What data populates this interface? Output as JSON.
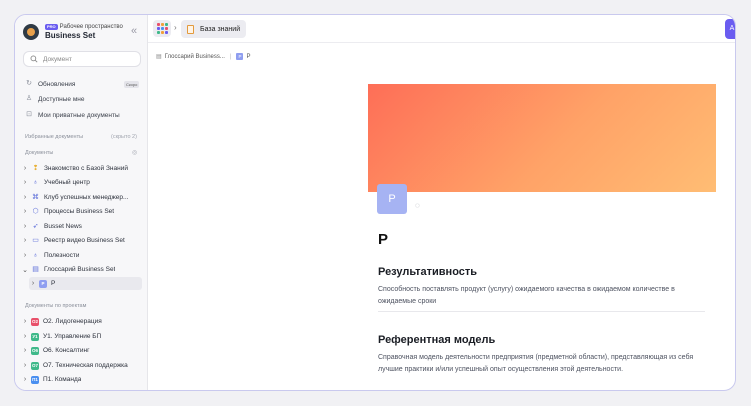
{
  "workspace": {
    "caption": "Рабочее пространство",
    "badge": "PRO",
    "name": "Business Set",
    "collapse": "«"
  },
  "search": {
    "placeholder": "Документ"
  },
  "nav": [
    {
      "label": "Обновления",
      "icon": "refresh-icon",
      "badge": "Скоро"
    },
    {
      "label": "Доступные мне",
      "icon": "user-icon"
    },
    {
      "label": "Мои приватные документы",
      "icon": "lock-icon"
    }
  ],
  "favorites": {
    "label": "Избранные документы",
    "hint": "(скрыто 2)"
  },
  "documents": {
    "label": "Документы",
    "items": [
      {
        "label": "Знакомство с Базой Знаний",
        "icon": "bulb-icon"
      },
      {
        "label": "Учебный центр",
        "icon": "lightbulb-icon"
      },
      {
        "label": "Клуб успешных менеджер...",
        "icon": "gamepad-icon"
      },
      {
        "label": "Процессы Business Set",
        "icon": "shield-icon"
      },
      {
        "label": "Busset News",
        "icon": "rocket-icon"
      },
      {
        "label": "Реестр видео Business Set",
        "icon": "folder-icon"
      },
      {
        "label": "Полезности",
        "icon": "lightbulb-icon"
      },
      {
        "label": "Глоссарий Business Set",
        "icon": "book-icon"
      }
    ],
    "selected_child": {
      "label": "Р",
      "badge": "Р"
    }
  },
  "projects": {
    "label": "Документы по проектам",
    "items": [
      {
        "label": "О2. Лидогенерация",
        "badge": "О2",
        "color": "#e8506a"
      },
      {
        "label": "У1. Управление БП",
        "badge": "У1",
        "color": "#3fb98a"
      },
      {
        "label": "О6. Консалтинг",
        "badge": "О6",
        "color": "#3fb98a"
      },
      {
        "label": "О7. Техническая поддержка",
        "badge": "О7",
        "color": "#3fb98a"
      },
      {
        "label": "П1. Команда",
        "badge": "П1",
        "color": "#4a8ff0"
      }
    ]
  },
  "topbar": {
    "tab_label": "База знаний",
    "right_button": "А"
  },
  "breadcrumb": {
    "parent": "Глоссарий Business...",
    "current": "Р",
    "current_badge": "Р"
  },
  "page": {
    "icon_letter": "Р",
    "title": "Р",
    "terms": [
      {
        "term": "Результативность",
        "definition": "Способность поставлять продукт (услугу) ожидаемого качества в ожидаемом количестве в ожидаемые сроки"
      },
      {
        "term": "Референтная модель",
        "definition": "Справочная модель деятельности предприятия (предметной области), представляющая из себя лучшие практики и/или успешный опыт осуществления этой деятельности."
      }
    ]
  },
  "colors": {
    "accent": "#6a5cf0",
    "cover_start": "#fe6e57",
    "cover_end": "#ffbd74",
    "page_icon": "#a6b3f3"
  }
}
